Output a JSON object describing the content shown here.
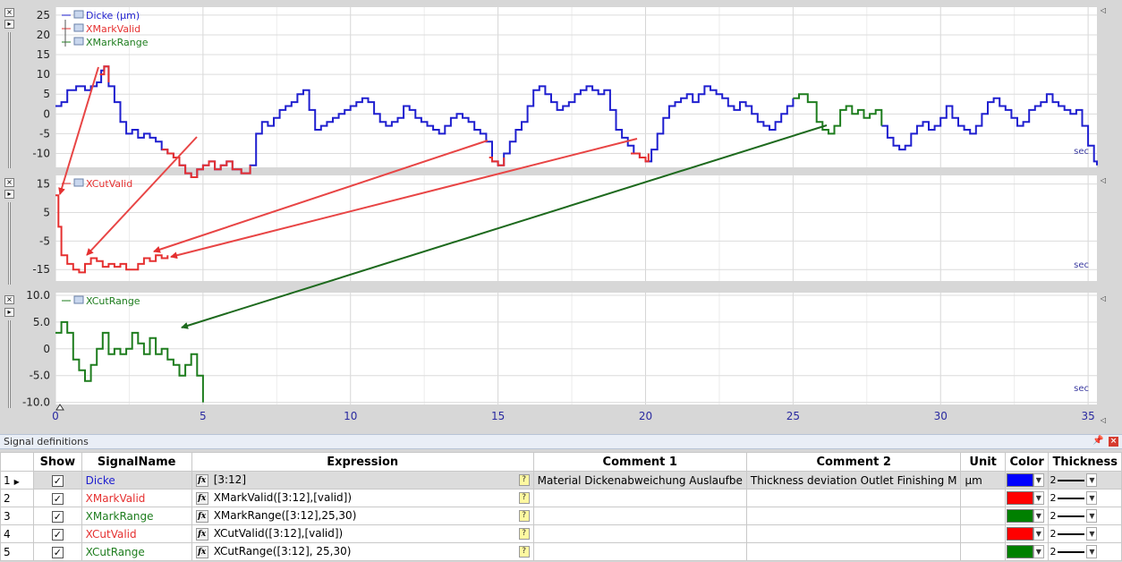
{
  "charts": [
    {
      "id": "chart1",
      "legend": [
        {
          "name": "Dicke (µm)",
          "color": "#1f1fcf"
        },
        {
          "name": "XMarkValid",
          "color": "#e53030"
        },
        {
          "name": "XMarkRange",
          "color": "#1e7d1e"
        }
      ],
      "y_ticks": [
        "25",
        "20",
        "15",
        "10",
        "5",
        "0",
        "-5",
        "-10"
      ],
      "unit_label": "sec"
    },
    {
      "id": "chart2",
      "legend": [
        {
          "name": "XCutValid",
          "color": "#e53030"
        }
      ],
      "y_ticks": [
        "15",
        "5",
        "-5",
        "-15"
      ],
      "unit_label": "sec"
    },
    {
      "id": "chart3",
      "legend": [
        {
          "name": "XCutRange",
          "color": "#1e7d1e"
        }
      ],
      "y_ticks": [
        "10.0",
        "5.0",
        "0",
        "-5.0",
        "-10.0"
      ],
      "unit_label": "sec"
    }
  ],
  "x_axis": {
    "ticks": [
      "0",
      "5",
      "10",
      "15",
      "20",
      "25",
      "30",
      "35"
    ],
    "min": 0,
    "max": 35.3
  },
  "series": {
    "dicke": [
      [
        0,
        2
      ],
      [
        0.2,
        3
      ],
      [
        0.4,
        6
      ],
      [
        0.7,
        7
      ],
      [
        1,
        6
      ],
      [
        1.2,
        7
      ],
      [
        1.4,
        8
      ],
      [
        1.55,
        11
      ],
      [
        1.65,
        12
      ],
      [
        1.8,
        7
      ],
      [
        2.0,
        3
      ],
      [
        2.2,
        -2
      ],
      [
        2.4,
        -5
      ],
      [
        2.6,
        -4
      ],
      [
        2.8,
        -6
      ],
      [
        3,
        -5
      ],
      [
        3.2,
        -6
      ],
      [
        3.4,
        -7
      ],
      [
        3.6,
        -9
      ],
      [
        3.8,
        -10
      ],
      [
        4.0,
        -11
      ],
      [
        4.2,
        -13
      ],
      [
        4.4,
        -15
      ],
      [
        4.6,
        -16
      ],
      [
        4.8,
        -14
      ],
      [
        5.0,
        -13
      ],
      [
        5.2,
        -12
      ],
      [
        5.4,
        -14
      ],
      [
        5.6,
        -13
      ],
      [
        5.8,
        -12
      ],
      [
        6.0,
        -14
      ],
      [
        6.3,
        -15
      ],
      [
        6.6,
        -13
      ],
      [
        6.8,
        -5
      ],
      [
        7.0,
        -2
      ],
      [
        7.2,
        -3
      ],
      [
        7.4,
        -1
      ],
      [
        7.6,
        1
      ],
      [
        7.8,
        2
      ],
      [
        8.0,
        3
      ],
      [
        8.2,
        5
      ],
      [
        8.4,
        6
      ],
      [
        8.6,
        1
      ],
      [
        8.8,
        -4
      ],
      [
        9.0,
        -3
      ],
      [
        9.2,
        -2
      ],
      [
        9.4,
        -1
      ],
      [
        9.6,
        0
      ],
      [
        9.8,
        1
      ],
      [
        10.0,
        2
      ],
      [
        10.2,
        3
      ],
      [
        10.4,
        4
      ],
      [
        10.6,
        3
      ],
      [
        10.8,
        0
      ],
      [
        11.0,
        -2
      ],
      [
        11.2,
        -3
      ],
      [
        11.4,
        -2
      ],
      [
        11.6,
        -1
      ],
      [
        11.8,
        2
      ],
      [
        12.0,
        1
      ],
      [
        12.2,
        -1
      ],
      [
        12.4,
        -2
      ],
      [
        12.6,
        -3
      ],
      [
        12.8,
        -4
      ],
      [
        13.0,
        -5
      ],
      [
        13.2,
        -3
      ],
      [
        13.4,
        -1
      ],
      [
        13.6,
        0
      ],
      [
        13.8,
        -1
      ],
      [
        14.0,
        -2
      ],
      [
        14.2,
        -4
      ],
      [
        14.4,
        -5
      ],
      [
        14.6,
        -7
      ],
      [
        14.8,
        -12
      ],
      [
        15.0,
        -13
      ],
      [
        15.2,
        -10
      ],
      [
        15.4,
        -7
      ],
      [
        15.6,
        -4
      ],
      [
        15.8,
        -2
      ],
      [
        16.0,
        2
      ],
      [
        16.2,
        6
      ],
      [
        16.4,
        7
      ],
      [
        16.6,
        5
      ],
      [
        16.8,
        3
      ],
      [
        17.0,
        1
      ],
      [
        17.2,
        2
      ],
      [
        17.4,
        3
      ],
      [
        17.6,
        5
      ],
      [
        17.8,
        6
      ],
      [
        18.0,
        7
      ],
      [
        18.2,
        6
      ],
      [
        18.4,
        5
      ],
      [
        18.6,
        6
      ],
      [
        18.8,
        1
      ],
      [
        19.0,
        -4
      ],
      [
        19.2,
        -6
      ],
      [
        19.4,
        -8
      ],
      [
        19.6,
        -10
      ],
      [
        19.8,
        -11
      ],
      [
        20.0,
        -12
      ],
      [
        20.2,
        -9
      ],
      [
        20.4,
        -5
      ],
      [
        20.6,
        -1
      ],
      [
        20.8,
        2
      ],
      [
        21.0,
        3
      ],
      [
        21.2,
        4
      ],
      [
        21.4,
        5
      ],
      [
        21.6,
        3
      ],
      [
        21.8,
        5
      ],
      [
        22.0,
        7
      ],
      [
        22.2,
        6
      ],
      [
        22.4,
        5
      ],
      [
        22.6,
        4
      ],
      [
        22.8,
        2
      ],
      [
        23.0,
        1
      ],
      [
        23.2,
        3
      ],
      [
        23.4,
        2
      ],
      [
        23.6,
        0
      ],
      [
        23.8,
        -2
      ],
      [
        24.0,
        -3
      ],
      [
        24.2,
        -4
      ],
      [
        24.4,
        -2
      ],
      [
        24.6,
        0
      ],
      [
        24.8,
        2
      ],
      [
        25.0,
        4
      ]
    ],
    "dicke2": [
      [
        28.0,
        -3
      ],
      [
        28.2,
        -6
      ],
      [
        28.4,
        -8
      ],
      [
        28.6,
        -9
      ],
      [
        28.8,
        -8
      ],
      [
        29.0,
        -5
      ],
      [
        29.2,
        -3
      ],
      [
        29.4,
        -2
      ],
      [
        29.6,
        -4
      ],
      [
        29.8,
        -3
      ],
      [
        30.0,
        -1
      ],
      [
        30.2,
        2
      ],
      [
        30.4,
        -1
      ],
      [
        30.6,
        -3
      ],
      [
        30.8,
        -4
      ],
      [
        31.0,
        -5
      ],
      [
        31.2,
        -3
      ],
      [
        31.4,
        0
      ],
      [
        31.6,
        3
      ],
      [
        31.8,
        4
      ],
      [
        32.0,
        2
      ],
      [
        32.2,
        1
      ],
      [
        32.4,
        -1
      ],
      [
        32.6,
        -3
      ],
      [
        32.8,
        -2
      ],
      [
        33.0,
        1
      ],
      [
        33.2,
        2
      ],
      [
        33.4,
        3
      ],
      [
        33.6,
        5
      ],
      [
        33.8,
        3
      ],
      [
        34.0,
        2
      ],
      [
        34.2,
        1
      ],
      [
        34.4,
        0
      ],
      [
        34.6,
        1
      ],
      [
        34.8,
        -3
      ],
      [
        35.0,
        -8
      ],
      [
        35.2,
        -12
      ],
      [
        35.3,
        -13
      ]
    ],
    "xmarkvalid": [
      [
        1.5,
        10
      ],
      [
        1.65,
        12
      ],
      [
        1.8,
        8
      ]
    ],
    "xmarkvalid2": [
      [
        3.6,
        -9
      ],
      [
        3.8,
        -10
      ],
      [
        4.0,
        -11
      ],
      [
        4.2,
        -13
      ],
      [
        4.4,
        -15
      ],
      [
        4.6,
        -16
      ],
      [
        4.8,
        -14
      ],
      [
        5.0,
        -13
      ],
      [
        5.2,
        -12
      ],
      [
        5.4,
        -14
      ],
      [
        5.6,
        -13
      ],
      [
        5.8,
        -12
      ],
      [
        6.0,
        -14
      ],
      [
        6.3,
        -15
      ],
      [
        6.6,
        -13
      ]
    ],
    "xmarkvalid3": [
      [
        14.7,
        -11
      ],
      [
        14.8,
        -12
      ],
      [
        15.0,
        -13
      ],
      [
        15.2,
        -11
      ]
    ],
    "xmarkvalid4": [
      [
        19.5,
        -10
      ],
      [
        19.8,
        -11
      ],
      [
        20.0,
        -12
      ],
      [
        20.1,
        -10
      ]
    ],
    "xmarkrange": [
      [
        25.0,
        4
      ],
      [
        25.2,
        5
      ],
      [
        25.5,
        3
      ],
      [
        25.8,
        -2
      ],
      [
        26.0,
        -4
      ],
      [
        26.2,
        -5
      ],
      [
        26.4,
        -3
      ],
      [
        26.6,
        1
      ],
      [
        26.8,
        2
      ],
      [
        27.0,
        0
      ],
      [
        27.2,
        1
      ],
      [
        27.4,
        -1
      ],
      [
        27.6,
        0
      ],
      [
        27.8,
        1
      ],
      [
        28.0,
        -3
      ]
    ],
    "xcutvalid": [
      [
        0,
        11
      ],
      [
        0.1,
        0
      ],
      [
        0.2,
        -10
      ],
      [
        0.4,
        -13
      ],
      [
        0.6,
        -15
      ],
      [
        0.8,
        -16
      ],
      [
        1.0,
        -13
      ],
      [
        1.2,
        -11
      ],
      [
        1.4,
        -12
      ],
      [
        1.6,
        -14
      ],
      [
        1.8,
        -13
      ],
      [
        2.0,
        -14
      ],
      [
        2.2,
        -13
      ],
      [
        2.4,
        -15
      ],
      [
        2.6,
        -15
      ],
      [
        2.8,
        -13
      ],
      [
        3.0,
        -11
      ],
      [
        3.2,
        -12
      ],
      [
        3.4,
        -10
      ],
      [
        3.6,
        -11
      ],
      [
        3.8,
        -10
      ]
    ],
    "xcutrange": [
      [
        0,
        3
      ],
      [
        0.2,
        5
      ],
      [
        0.4,
        3
      ],
      [
        0.6,
        -2
      ],
      [
        0.8,
        -4
      ],
      [
        1.0,
        -6
      ],
      [
        1.2,
        -3
      ],
      [
        1.4,
        0
      ],
      [
        1.6,
        3
      ],
      [
        1.8,
        -1
      ],
      [
        2.0,
        0
      ],
      [
        2.2,
        -1
      ],
      [
        2.4,
        0
      ],
      [
        2.6,
        3
      ],
      [
        2.8,
        1
      ],
      [
        3.0,
        -1
      ],
      [
        3.2,
        2
      ],
      [
        3.4,
        -1
      ],
      [
        3.6,
        0
      ],
      [
        3.8,
        -2
      ],
      [
        4.0,
        -3
      ],
      [
        4.2,
        -5
      ],
      [
        4.4,
        -3
      ],
      [
        4.6,
        -1
      ],
      [
        4.8,
        -5
      ],
      [
        5.0,
        -10
      ]
    ]
  },
  "panel": {
    "title": "Signal definitions",
    "columns": {
      "show": "Show",
      "signal_name": "SignalName",
      "expression": "Expression",
      "comment1": "Comment 1",
      "comment2": "Comment 2",
      "unit": "Unit",
      "color": "Color",
      "thickness": "Thickness"
    },
    "rows": [
      {
        "num": "1",
        "signal_name": "Dicke",
        "name_color": "#1f1fcf",
        "expression": "[3:12]",
        "comment1": "Material Dickenabweichung Auslaufbe",
        "comment2": "Thickness deviation Outlet Finishing M",
        "unit": "µm",
        "color": "#0000ff",
        "thickness": "2",
        "selected": true
      },
      {
        "num": "2",
        "signal_name": "XMarkValid",
        "name_color": "#e53030",
        "expression": "XMarkValid([3:12],[valid])",
        "comment1": "",
        "comment2": "",
        "unit": "",
        "color": "#ff0000",
        "thickness": "2",
        "selected": false
      },
      {
        "num": "3",
        "signal_name": "XMarkRange",
        "name_color": "#1e7d1e",
        "expression": "XMarkRange([3:12],25,30)",
        "comment1": "",
        "comment2": "",
        "unit": "",
        "color": "#008000",
        "thickness": "2",
        "selected": false
      },
      {
        "num": "4",
        "signal_name": "XCutValid",
        "name_color": "#e53030",
        "expression": "XCutValid([3:12],[valid])",
        "comment1": "",
        "comment2": "",
        "unit": "",
        "color": "#ff0000",
        "thickness": "2",
        "selected": false
      },
      {
        "num": "5",
        "signal_name": "XCutRange",
        "name_color": "#1e7d1e",
        "expression": "XCutRange([3:12], 25,30)",
        "comment1": "",
        "comment2": "",
        "unit": "",
        "color": "#008000",
        "thickness": "2",
        "selected": false
      }
    ]
  }
}
